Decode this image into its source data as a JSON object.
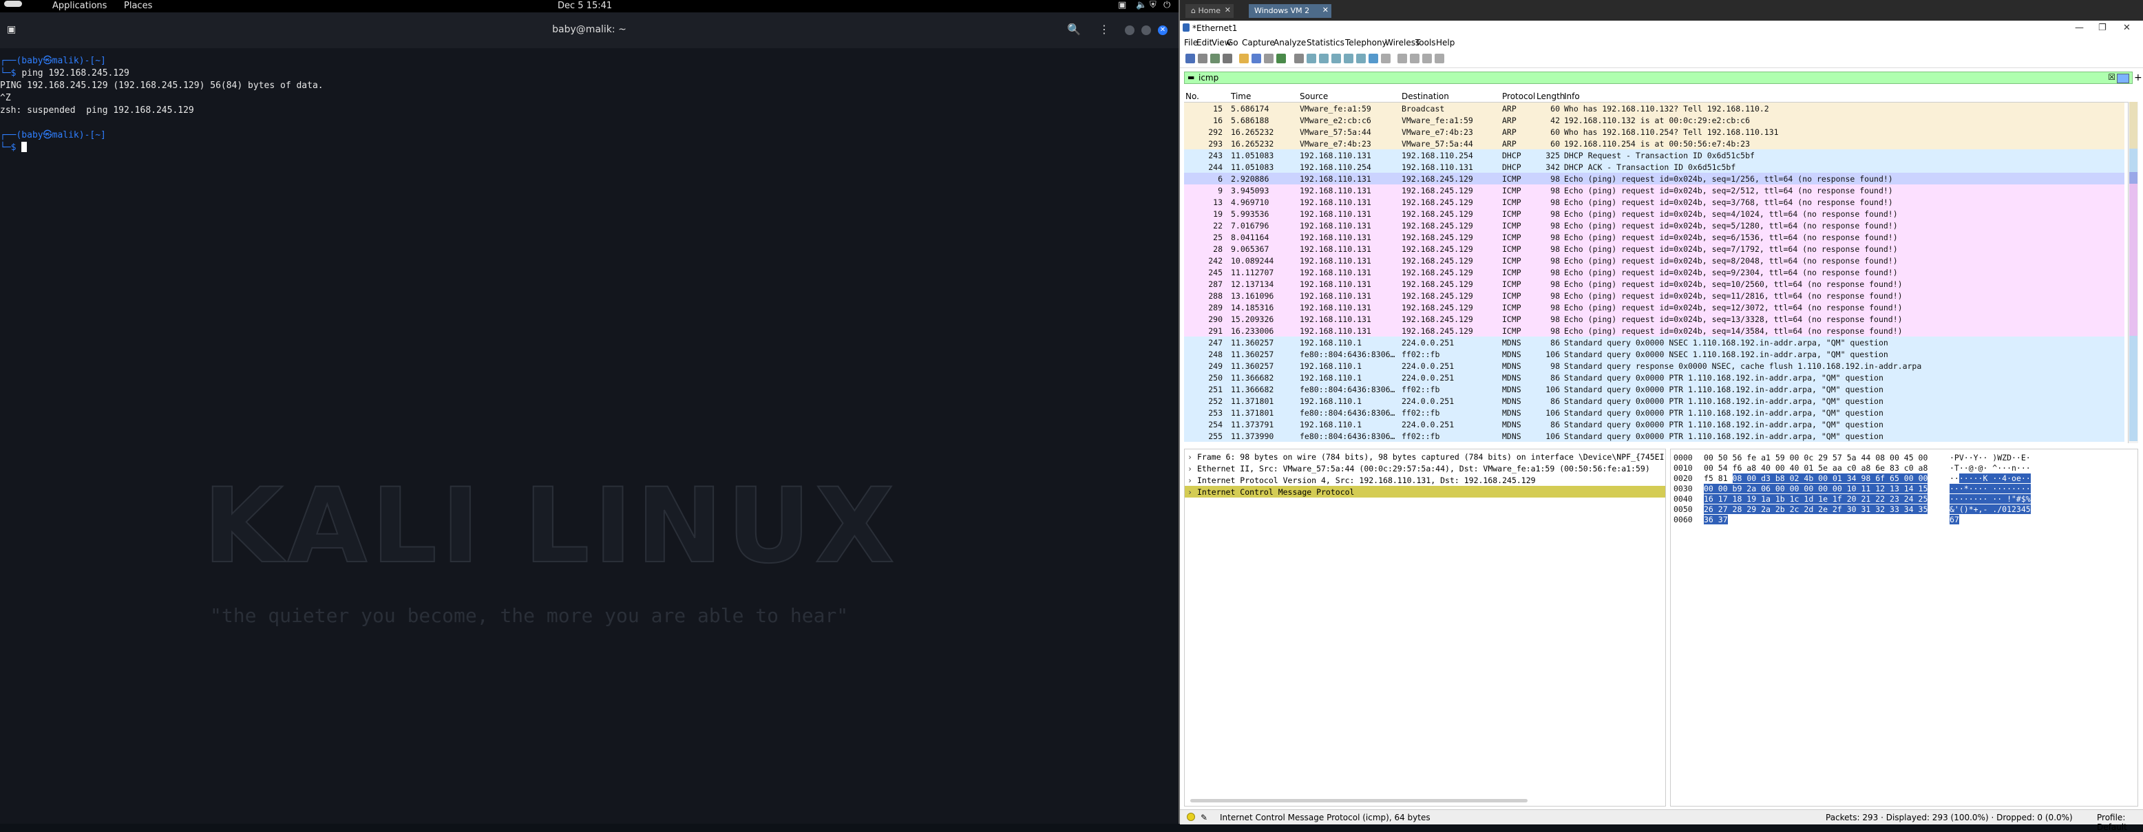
{
  "topbar": {
    "applications": "Applications",
    "places": "Places",
    "clock": "Dec 5  15:41"
  },
  "terminal": {
    "title": "baby@malik: ~",
    "lines": [
      {
        "kind": "prompt-top",
        "text": "┌──(baby㉿malik)-[~]"
      },
      {
        "kind": "prompt",
        "prefix": "└─$ ",
        "cmd": "ping 192.168.245.129"
      },
      {
        "kind": "out",
        "text": "PING 192.168.245.129 (192.168.245.129) 56(84) bytes of data."
      },
      {
        "kind": "out",
        "text": "^Z"
      },
      {
        "kind": "out",
        "text": "zsh: suspended  ping 192.168.245.129"
      },
      {
        "kind": "blank",
        "text": ""
      },
      {
        "kind": "prompt-top",
        "text": "┌──(baby㉿malik)-[~]"
      },
      {
        "kind": "cursor",
        "prefix": "└─$ "
      }
    ],
    "logo": "KALI LINUX",
    "quote": "\"the quieter you become, the more you are able to hear\""
  },
  "vm": {
    "tab_home": "Home",
    "tab_vm": "Windows VM 2",
    "window_title": "*Ethernet1"
  },
  "wireshark": {
    "menu": [
      "File",
      "Edit",
      "View",
      "Go",
      "Capture",
      "Analyze",
      "Statistics",
      "Telephony",
      "Wireless",
      "Tools",
      "Help"
    ],
    "filter": "icmp",
    "columns": [
      "No.",
      "Time",
      "Source",
      "Destination",
      "Protocol",
      "Length",
      "Info"
    ],
    "packets": [
      {
        "no": "15",
        "time": "5.686174",
        "src": "VMware_fe:a1:59",
        "dst": "Broadcast",
        "proto": "ARP",
        "len": "60",
        "info": "Who has 192.168.110.132? Tell 192.168.110.2",
        "cls": "arp"
      },
      {
        "no": "16",
        "time": "5.686188",
        "src": "VMware_e2:cb:c6",
        "dst": "VMware_fe:a1:59",
        "proto": "ARP",
        "len": "42",
        "info": "192.168.110.132 is at 00:0c:29:e2:cb:c6",
        "cls": "arp"
      },
      {
        "no": "292",
        "time": "16.265232",
        "src": "VMware_57:5a:44",
        "dst": "VMware_e7:4b:23",
        "proto": "ARP",
        "len": "60",
        "info": "Who has 192.168.110.254? Tell 192.168.110.131",
        "cls": "arp"
      },
      {
        "no": "293",
        "time": "16.265232",
        "src": "VMware_e7:4b:23",
        "dst": "VMware_57:5a:44",
        "proto": "ARP",
        "len": "60",
        "info": "192.168.110.254 is at 00:50:56:e7:4b:23",
        "cls": "arp"
      },
      {
        "no": "243",
        "time": "11.051083",
        "src": "192.168.110.131",
        "dst": "192.168.110.254",
        "proto": "DHCP",
        "len": "325",
        "info": "DHCP Request  - Transaction ID 0x6d51c5bf",
        "cls": "udp"
      },
      {
        "no": "244",
        "time": "11.051083",
        "src": "192.168.110.254",
        "dst": "192.168.110.131",
        "proto": "DHCP",
        "len": "342",
        "info": "DHCP ACK      - Transaction ID 0x6d51c5bf",
        "cls": "udp"
      },
      {
        "no": "6",
        "time": "2.920886",
        "src": "192.168.110.131",
        "dst": "192.168.245.129",
        "proto": "ICMP",
        "len": "98",
        "info": "Echo (ping) request  id=0x024b, seq=1/256, ttl=64 (no response found!)",
        "cls": "sel"
      },
      {
        "no": "9",
        "time": "3.945093",
        "src": "192.168.110.131",
        "dst": "192.168.245.129",
        "proto": "ICMP",
        "len": "98",
        "info": "Echo (ping) request  id=0x024b, seq=2/512, ttl=64 (no response found!)",
        "cls": "icmp"
      },
      {
        "no": "13",
        "time": "4.969710",
        "src": "192.168.110.131",
        "dst": "192.168.245.129",
        "proto": "ICMP",
        "len": "98",
        "info": "Echo (ping) request  id=0x024b, seq=3/768, ttl=64 (no response found!)",
        "cls": "icmp"
      },
      {
        "no": "19",
        "time": "5.993536",
        "src": "192.168.110.131",
        "dst": "192.168.245.129",
        "proto": "ICMP",
        "len": "98",
        "info": "Echo (ping) request  id=0x024b, seq=4/1024, ttl=64 (no response found!)",
        "cls": "icmp"
      },
      {
        "no": "22",
        "time": "7.016796",
        "src": "192.168.110.131",
        "dst": "192.168.245.129",
        "proto": "ICMP",
        "len": "98",
        "info": "Echo (ping) request  id=0x024b, seq=5/1280, ttl=64 (no response found!)",
        "cls": "icmp"
      },
      {
        "no": "25",
        "time": "8.041164",
        "src": "192.168.110.131",
        "dst": "192.168.245.129",
        "proto": "ICMP",
        "len": "98",
        "info": "Echo (ping) request  id=0x024b, seq=6/1536, ttl=64 (no response found!)",
        "cls": "icmp"
      },
      {
        "no": "28",
        "time": "9.065367",
        "src": "192.168.110.131",
        "dst": "192.168.245.129",
        "proto": "ICMP",
        "len": "98",
        "info": "Echo (ping) request  id=0x024b, seq=7/1792, ttl=64 (no response found!)",
        "cls": "icmp"
      },
      {
        "no": "242",
        "time": "10.089244",
        "src": "192.168.110.131",
        "dst": "192.168.245.129",
        "proto": "ICMP",
        "len": "98",
        "info": "Echo (ping) request  id=0x024b, seq=8/2048, ttl=64 (no response found!)",
        "cls": "icmp"
      },
      {
        "no": "245",
        "time": "11.112707",
        "src": "192.168.110.131",
        "dst": "192.168.245.129",
        "proto": "ICMP",
        "len": "98",
        "info": "Echo (ping) request  id=0x024b, seq=9/2304, ttl=64 (no response found!)",
        "cls": "icmp"
      },
      {
        "no": "287",
        "time": "12.137134",
        "src": "192.168.110.131",
        "dst": "192.168.245.129",
        "proto": "ICMP",
        "len": "98",
        "info": "Echo (ping) request  id=0x024b, seq=10/2560, ttl=64 (no response found!)",
        "cls": "icmp"
      },
      {
        "no": "288",
        "time": "13.161096",
        "src": "192.168.110.131",
        "dst": "192.168.245.129",
        "proto": "ICMP",
        "len": "98",
        "info": "Echo (ping) request  id=0x024b, seq=11/2816, ttl=64 (no response found!)",
        "cls": "icmp"
      },
      {
        "no": "289",
        "time": "14.185316",
        "src": "192.168.110.131",
        "dst": "192.168.245.129",
        "proto": "ICMP",
        "len": "98",
        "info": "Echo (ping) request  id=0x024b, seq=12/3072, ttl=64 (no response found!)",
        "cls": "icmp"
      },
      {
        "no": "290",
        "time": "15.209326",
        "src": "192.168.110.131",
        "dst": "192.168.245.129",
        "proto": "ICMP",
        "len": "98",
        "info": "Echo (ping) request  id=0x024b, seq=13/3328, ttl=64 (no response found!)",
        "cls": "icmp"
      },
      {
        "no": "291",
        "time": "16.233006",
        "src": "192.168.110.131",
        "dst": "192.168.245.129",
        "proto": "ICMP",
        "len": "98",
        "info": "Echo (ping) request  id=0x024b, seq=14/3584, ttl=64 (no response found!)",
        "cls": "icmp"
      },
      {
        "no": "247",
        "time": "11.360257",
        "src": "192.168.110.1",
        "dst": "224.0.0.251",
        "proto": "MDNS",
        "len": "86",
        "info": "Standard query 0x0000 NSEC 1.110.168.192.in-addr.arpa, \"QM\" question",
        "cls": "udp"
      },
      {
        "no": "248",
        "time": "11.360257",
        "src": "fe80::804:6436:8306…",
        "dst": "ff02::fb",
        "proto": "MDNS",
        "len": "106",
        "info": "Standard query 0x0000 NSEC 1.110.168.192.in-addr.arpa, \"QM\" question",
        "cls": "udp"
      },
      {
        "no": "249",
        "time": "11.360257",
        "src": "192.168.110.1",
        "dst": "224.0.0.251",
        "proto": "MDNS",
        "len": "98",
        "info": "Standard query response 0x0000 NSEC, cache flush 1.110.168.192.in-addr.arpa",
        "cls": "udp"
      },
      {
        "no": "250",
        "time": "11.366682",
        "src": "192.168.110.1",
        "dst": "224.0.0.251",
        "proto": "MDNS",
        "len": "86",
        "info": "Standard query 0x0000 PTR 1.110.168.192.in-addr.arpa, \"QM\" question",
        "cls": "udp"
      },
      {
        "no": "251",
        "time": "11.366682",
        "src": "fe80::804:6436:8306…",
        "dst": "ff02::fb",
        "proto": "MDNS",
        "len": "106",
        "info": "Standard query 0x0000 PTR 1.110.168.192.in-addr.arpa, \"QM\" question",
        "cls": "udp"
      },
      {
        "no": "252",
        "time": "11.371801",
        "src": "192.168.110.1",
        "dst": "224.0.0.251",
        "proto": "MDNS",
        "len": "86",
        "info": "Standard query 0x0000 PTR 1.110.168.192.in-addr.arpa, \"QM\" question",
        "cls": "udp"
      },
      {
        "no": "253",
        "time": "11.371801",
        "src": "fe80::804:6436:8306…",
        "dst": "ff02::fb",
        "proto": "MDNS",
        "len": "106",
        "info": "Standard query 0x0000 PTR 1.110.168.192.in-addr.arpa, \"QM\" question",
        "cls": "udp"
      },
      {
        "no": "254",
        "time": "11.373791",
        "src": "192.168.110.1",
        "dst": "224.0.0.251",
        "proto": "MDNS",
        "len": "86",
        "info": "Standard query 0x0000 PTR 1.110.168.192.in-addr.arpa, \"QM\" question",
        "cls": "udp"
      },
      {
        "no": "255",
        "time": "11.373990",
        "src": "fe80::804:6436:8306…",
        "dst": "ff02::fb",
        "proto": "MDNS",
        "len": "106",
        "info": "Standard query 0x0000 PTR 1.110.168.192.in-addr.arpa, \"QM\" question",
        "cls": "udp"
      }
    ],
    "details": [
      {
        "text": "Frame 6: 98 bytes on wire (784 bits), 98 bytes captured (784 bits) on interface \\Device\\NPF_{745EI",
        "sel": false
      },
      {
        "text": "Ethernet II, Src: VMware_57:5a:44 (00:0c:29:57:5a:44), Dst: VMware_fe:a1:59 (00:50:56:fe:a1:59)",
        "sel": false
      },
      {
        "text": "Internet Protocol Version 4, Src: 192.168.110.131, Dst: 192.168.245.129",
        "sel": false
      },
      {
        "text": "Internet Control Message Protocol",
        "sel": true
      }
    ],
    "bytes": [
      {
        "off": "0000",
        "pre": "00 50 56 fe a1 59 00 0c  29 57 5a 44 08 00 45 00",
        "hl": "",
        "asc_pre": "·PV··Y·· )WZD··E·",
        "asc_hl": ""
      },
      {
        "off": "0010",
        "pre": "00 54 f6 a8 40 00 40 01  5e aa c0 a8 6e 83 c0 a8",
        "hl": "",
        "asc_pre": "·T··@·@· ^···n···",
        "asc_hl": ""
      },
      {
        "off": "0020",
        "pre": "f5 81 ",
        "hl": "08 00 d3 b8 02 4b  00 01 34 98 6f 65 00 00",
        "asc_pre": "··",
        "asc_hl": "·····K ··4·oe··"
      },
      {
        "off": "0030",
        "pre": "",
        "hl": "00 00 b9 2a 06 00 00 00  00 00 10 11 12 13 14 15",
        "asc_pre": "",
        "asc_hl": "···*···· ········"
      },
      {
        "off": "0040",
        "pre": "",
        "hl": "16 17 18 19 1a 1b 1c 1d  1e 1f 20 21 22 23 24 25",
        "asc_pre": "",
        "asc_hl": "········ ·· !\"#$%"
      },
      {
        "off": "0050",
        "pre": "",
        "hl": "26 27 28 29 2a 2b 2c 2d  2e 2f 30 31 32 33 34 35",
        "asc_pre": "",
        "asc_hl": "&'()*+,- ./012345"
      },
      {
        "off": "0060",
        "pre": "",
        "hl": "36 37",
        "asc_pre": "",
        "asc_hl": "67"
      }
    ],
    "status": {
      "left": "Internet Control Message Protocol (icmp), 64 bytes",
      "packets": "Packets: 293 · Displayed: 293 (100.0%) · Dropped: 0 (0.0%)",
      "profile": "Profile: Default"
    }
  }
}
